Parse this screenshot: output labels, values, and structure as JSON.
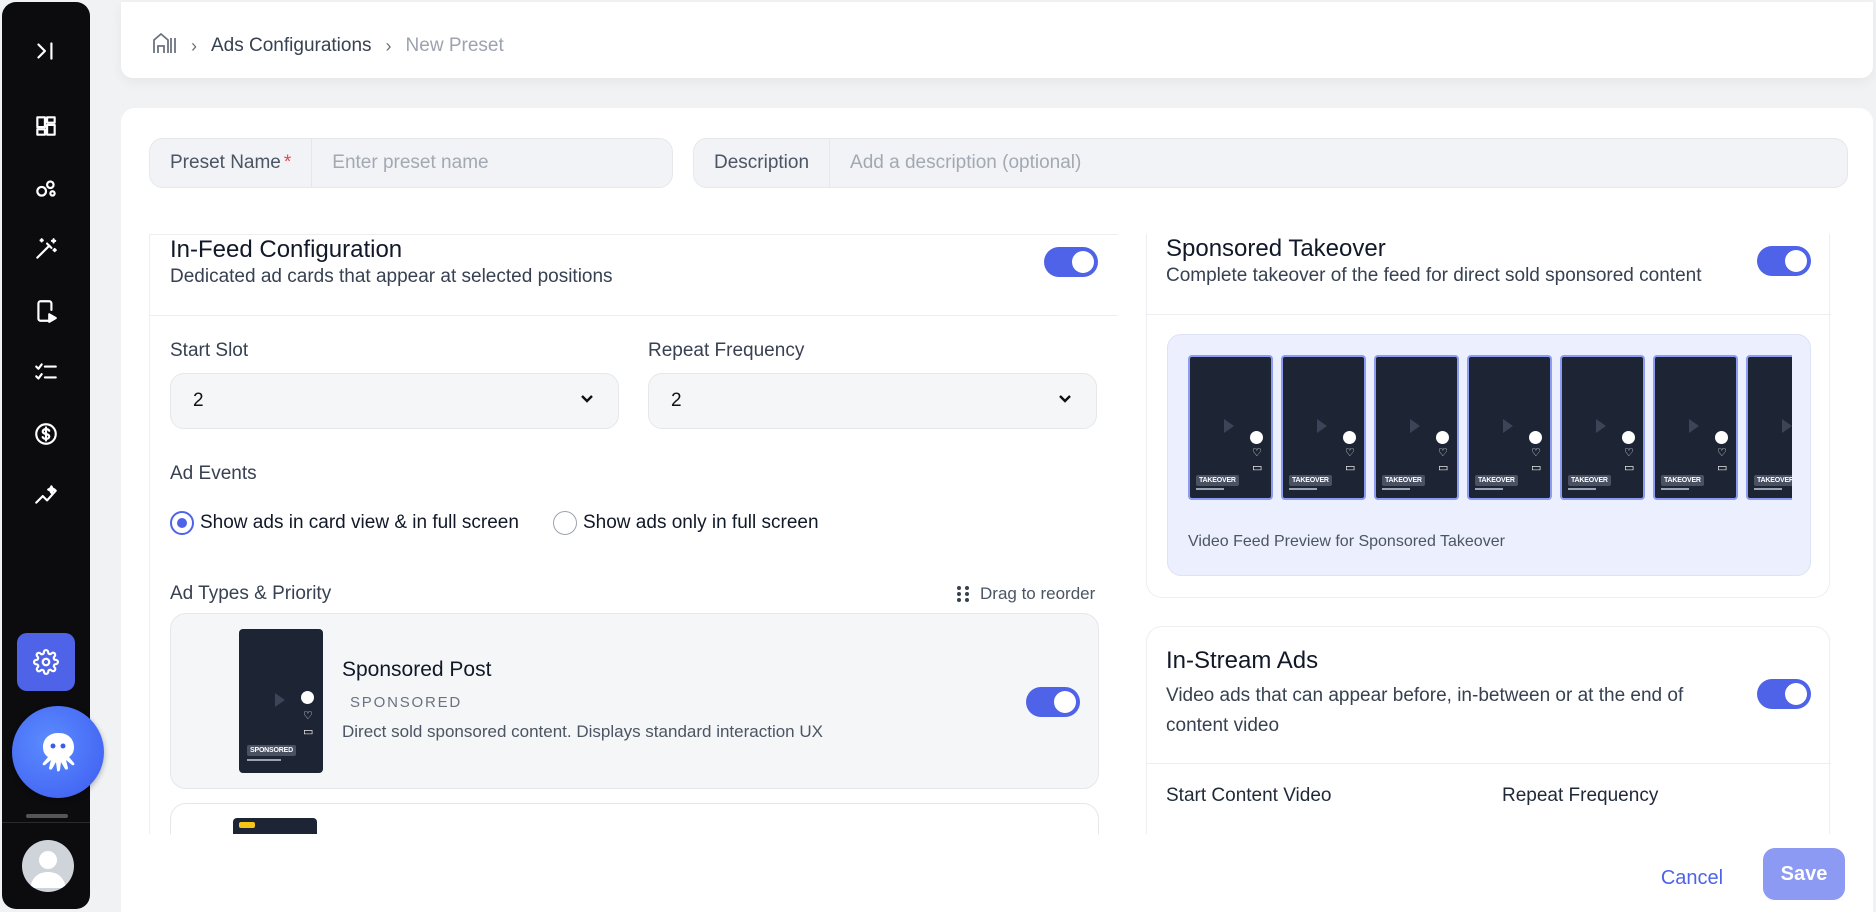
{
  "breadcrumb": {
    "parent": "Ads Configurations",
    "current": "New Preset"
  },
  "form": {
    "preset_name_label": "Preset Name",
    "preset_name_required": "*",
    "preset_name_placeholder": "Enter preset name",
    "description_label": "Description",
    "description_placeholder": "Add a description (optional)"
  },
  "infeed": {
    "title": "In-Feed Configuration",
    "subtitle": "Dedicated ad cards that appear at selected positions",
    "enabled": true,
    "start_slot_label": "Start Slot",
    "start_slot_value": "2",
    "repeat_label": "Repeat Frequency",
    "repeat_value": "2",
    "ad_events_label": "Ad Events",
    "ad_events_options": [
      "Show ads in card view & in full screen",
      "Show ads only in full screen"
    ],
    "ad_events_selected": 0,
    "ad_types_label": "Ad Types & Priority",
    "drag_hint": "Drag to reorder",
    "ad_types": [
      {
        "name": "Sponsored Post",
        "tag": "SPONSORED",
        "description": "Direct sold sponsored content. Displays standard interaction UX",
        "badge": "SPONSORED",
        "enabled": true
      }
    ]
  },
  "takeover": {
    "title": "Sponsored Takeover",
    "subtitle": "Complete takeover of the feed for direct sold sponsored content",
    "enabled": true,
    "tile_badge": "TAKEOVER",
    "tiles": 7,
    "preview_caption": "Video Feed Preview for Sponsored Takeover"
  },
  "instream": {
    "title": "In-Stream Ads",
    "subtitle_line1": "Video ads that can appear before, in-between or at the end of",
    "subtitle_line2": "content video",
    "enabled": true,
    "start_label": "Start Content Video",
    "repeat_label": "Repeat Frequency"
  },
  "footer": {
    "cancel": "Cancel",
    "save": "Save"
  },
  "colors": {
    "accent": "#4f63e8",
    "sidebar": "#0c0c0f",
    "save_disabled": "#8c9af3"
  }
}
